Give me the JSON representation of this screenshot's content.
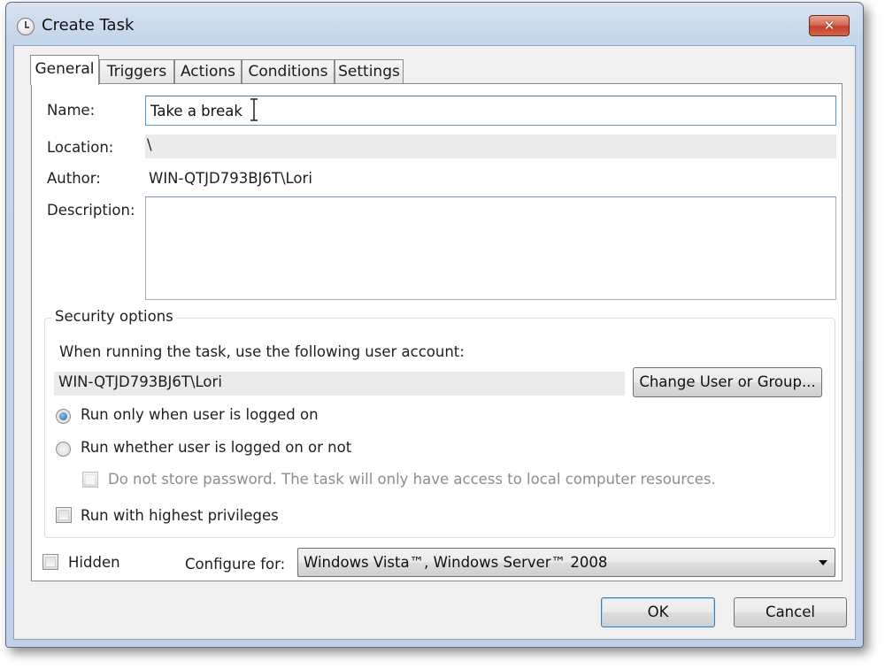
{
  "window": {
    "title": "Create Task",
    "close_symbol": "✕"
  },
  "tabs": [
    {
      "label": "General",
      "active": true
    },
    {
      "label": "Triggers",
      "active": false
    },
    {
      "label": "Actions",
      "active": false
    },
    {
      "label": "Conditions",
      "active": false
    },
    {
      "label": "Settings",
      "active": false
    }
  ],
  "general": {
    "name_label": "Name:",
    "name_value": "Take a break",
    "location_label": "Location:",
    "location_value": "\\",
    "author_label": "Author:",
    "author_value": "WIN-QTJD793BJ6T\\Lori",
    "description_label": "Description:",
    "description_value": ""
  },
  "security": {
    "group_title": "Security options",
    "account_prompt": "When running the task, use the following user account:",
    "account_value": "WIN-QTJD793BJ6T\\Lori",
    "change_user_button": "Change User or Group...",
    "radio_logged_on": "Run only when user is logged on",
    "radio_logged_on_checked": true,
    "radio_whether": "Run whether user is logged on or not",
    "radio_whether_checked": false,
    "no_store_password": "Do not store password.  The task will only have access to local computer resources.",
    "no_store_password_checked": false,
    "highest_privileges": "Run with highest privileges",
    "highest_privileges_checked": false
  },
  "bottom": {
    "hidden_label": "Hidden",
    "hidden_checked": false,
    "configure_label": "Configure for:",
    "configure_value": "Windows Vista™, Windows Server™ 2008"
  },
  "buttons": {
    "ok": "OK",
    "cancel": "Cancel"
  },
  "colors": {
    "titlebar": "#c6d6ea",
    "close_button": "#c2412a",
    "focus_border": "#5b9bd5",
    "default_button_border": "#3c7fb1"
  }
}
